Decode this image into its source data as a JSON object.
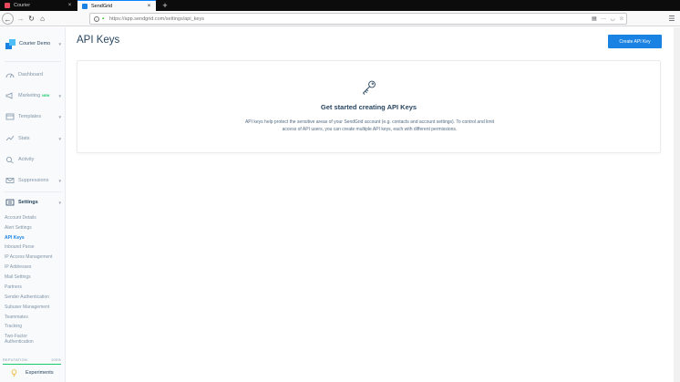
{
  "browser": {
    "tabs": [
      {
        "label": "Courier",
        "close": "×"
      },
      {
        "label": "SendGrid",
        "close": "×"
      }
    ],
    "new_tab": "+",
    "url": "https://app.sendgrid.com/settings/api_keys",
    "menu": "☰"
  },
  "sidebar": {
    "account_name": "Courier Demo",
    "nav": [
      {
        "label": "Dashboard",
        "icon": "dashboard-icon"
      },
      {
        "label": "Marketing",
        "badge": "NEW",
        "icon": "megaphone-icon"
      },
      {
        "label": "Templates",
        "icon": "templates-icon"
      },
      {
        "label": "Stats",
        "icon": "stats-icon"
      },
      {
        "label": "Activity",
        "icon": "activity-icon"
      },
      {
        "label": "Suppressions",
        "icon": "suppressions-icon"
      },
      {
        "label": "Settings",
        "icon": "settings-icon"
      }
    ],
    "settings_items": [
      "Account Details",
      "Alert Settings",
      "API Keys",
      "Inbound Parse",
      "IP Access Management",
      "IP Addresses",
      "Mail Settings",
      "Partners",
      "Sender Authentication",
      "Subuser Management",
      "Teammates",
      "Tracking",
      "Two-Factor",
      "Authentication"
    ],
    "active_settings_item": "API Keys",
    "reputation_label": "REPUTATION",
    "reputation_value": "100%",
    "reputation_fraction": 1.0,
    "experiments_label": "Experiments"
  },
  "main": {
    "title": "API Keys",
    "create_button": "Create API Key",
    "empty_heading": "Get started creating API Keys",
    "empty_description": "API keys help protect the sensitive areas of your SendGrid account (e.g. contacts and account settings). To control and limit access of API users, you can create multiple API keys, each with different permissions."
  },
  "colors": {
    "accent": "#1a82e2",
    "text": "#294661",
    "muted": "#8195a8",
    "new_badge": "#18c96e"
  }
}
